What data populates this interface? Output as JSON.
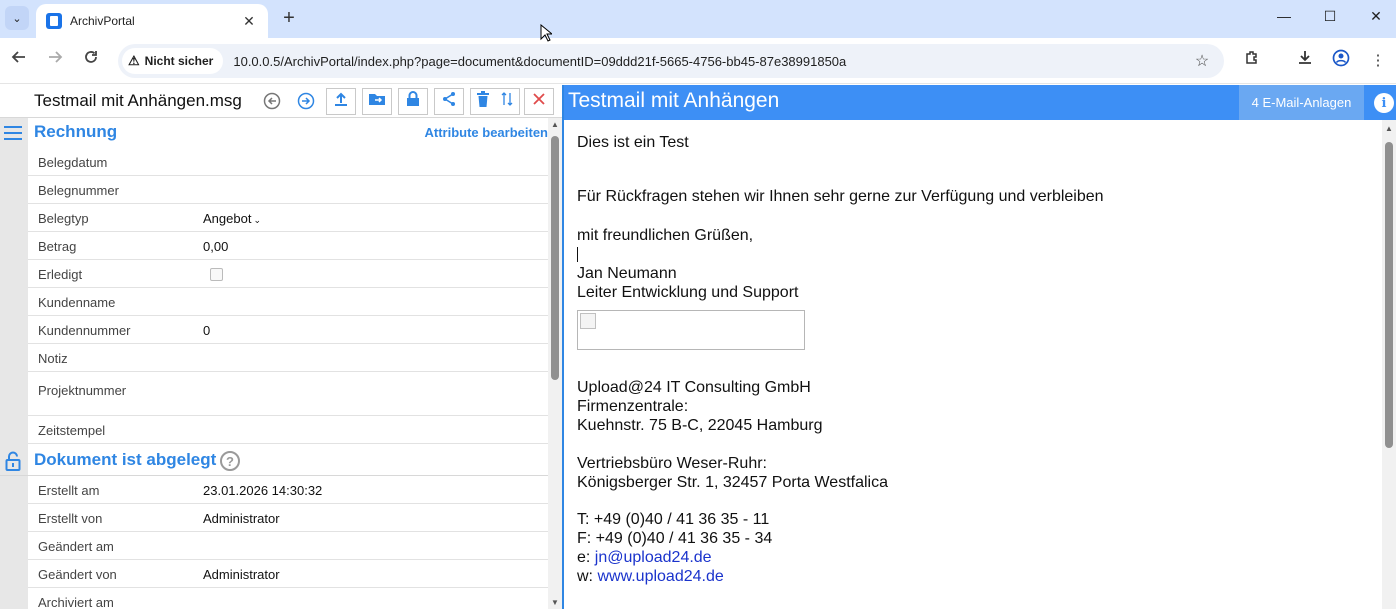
{
  "browser": {
    "tab_title": "ArchivPortal",
    "tab_close": "✕",
    "new_tab": "+",
    "security_label": "Nicht sicher",
    "url": "10.0.0.5/ArchivPortal/index.php?page=document&documentID=09ddd21f-5665-4756-bb45-87e38991850a",
    "window_controls": {
      "minimize": "—",
      "maximize": "☐",
      "close": "✕"
    }
  },
  "document": {
    "filename": "Testmail mit Anhängen.msg",
    "toolbar_icons": [
      "back-circle-icon",
      "forward-circle-icon",
      "upload-icon",
      "move-to-folder-icon",
      "lock-icon",
      "share-icon",
      "delete-icon",
      "sort-icon",
      "close-icon"
    ]
  },
  "attributes": {
    "section_title": "Rechnung",
    "edit_link": "Attribute bearbeiten",
    "fields": [
      {
        "label": "Belegdatum",
        "value": ""
      },
      {
        "label": "Belegnummer",
        "value": ""
      },
      {
        "label": "Belegtyp",
        "value": "Angebot"
      },
      {
        "label": "Betrag",
        "value": "0,00"
      },
      {
        "label": "Erledigt",
        "value": ""
      },
      {
        "label": "Kundenname",
        "value": ""
      },
      {
        "label": "Kundennummer",
        "value": "0"
      },
      {
        "label": "Notiz",
        "value": ""
      },
      {
        "label": "Projektnummer",
        "value": ""
      },
      {
        "label": "Zeitstempel",
        "value": ""
      }
    ]
  },
  "status": {
    "section_title": "Dokument ist abgelegt",
    "help_symbol": "?",
    "fields": [
      {
        "label": "Erstellt am",
        "value": "23.01.2026 14:30:32"
      },
      {
        "label": "Erstellt von",
        "value": "Administrator"
      },
      {
        "label": "Geändert am",
        "value": ""
      },
      {
        "label": "Geändert von",
        "value": "Administrator"
      },
      {
        "label": "Archiviert am",
        "value": ""
      }
    ]
  },
  "preview": {
    "title": "Testmail mit Anhängen",
    "attachments_button": "4 E-Mail-Anlagen",
    "info_symbol": "i",
    "body": {
      "line1": "Dies ist ein Test",
      "line2": "Für Rückfragen stehen wir Ihnen sehr gerne zur Verfügung und verbleiben",
      "line3": "mit freundlichen Grüßen,",
      "name": "Jan Neumann",
      "role": "Leiter Entwicklung und Support",
      "company": "Upload@24 IT Consulting GmbH",
      "hq_label": "Firmenzentrale:",
      "hq_address": "Kuehnstr. 75 B-C, 22045 Hamburg",
      "office_label": "Vertriebsbüro Weser-Ruhr:",
      "office_address": "Königsberger Str. 1, 32457 Porta Westfalica",
      "phone": "T: +49 (0)40 / 41 36 35 - 11",
      "fax": "F: +49 (0)40 / 41 36 35 - 34",
      "email_prefix": "e:",
      "email": "jn@upload24.de",
      "web_prefix": "w:",
      "web": "www.upload24.de"
    }
  },
  "colors": {
    "accent": "#2f86e3",
    "preview_header": "#3d8ff5",
    "attachments_button": "#6aa8f2"
  }
}
